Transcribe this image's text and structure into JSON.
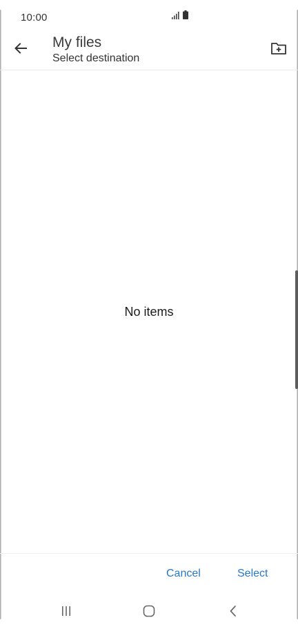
{
  "status_bar": {
    "time": "10:00",
    "signal_icon": "signal-icon",
    "battery_icon": "battery-icon"
  },
  "app_bar": {
    "back_icon": "arrow-back-icon",
    "title": "My files",
    "subtitle": "Select destination",
    "new_folder_icon": "create-folder-icon"
  },
  "content": {
    "empty_message": "No items"
  },
  "actions": {
    "cancel_label": "Cancel",
    "select_label": "Select"
  },
  "nav_bar": {
    "recents_icon": "recents-icon",
    "home_icon": "home-icon",
    "back_icon": "nav-back-icon"
  },
  "colors": {
    "accent": "#2878c8",
    "text_primary": "#1a1a1a",
    "background": "#ffffff"
  }
}
